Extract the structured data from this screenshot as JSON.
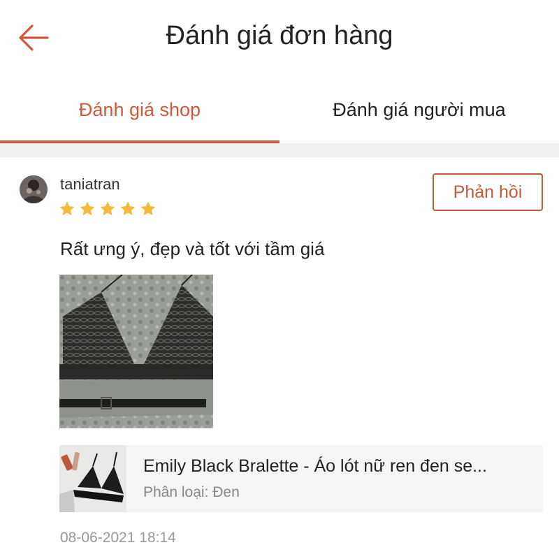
{
  "header": {
    "title": "Đánh giá đơn hàng",
    "back_icon": "back-arrow-icon"
  },
  "tabs": [
    {
      "label": "Đánh giá shop",
      "active": true
    },
    {
      "label": "Đánh giá người mua",
      "active": false
    }
  ],
  "colors": {
    "accent": "#d0593a",
    "star": "#f5b93b",
    "card_bg": "#f5f5f5"
  },
  "review": {
    "username": "taniatran",
    "rating": 5,
    "rating_max": 5,
    "reply_label": "Phản hồi",
    "comment": "Rất ưng ý, đẹp và tốt với tầm giá",
    "product": {
      "name": "Emily Black Bralette - Áo lót nữ ren đen se...",
      "variant": "Phân loại: Đen"
    },
    "timestamp": "08-06-2021 18:14"
  }
}
